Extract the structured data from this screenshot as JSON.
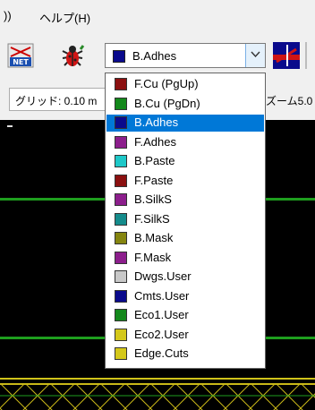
{
  "menubar": {
    "items": [
      "))",
      "ヘルプ(H)"
    ]
  },
  "toolbar": {
    "selected_layer": "B.Adhes",
    "selected_color": "#0a0a8c"
  },
  "status": {
    "grid": "グリッド: 0.10 m",
    "zoom": "ズーム5.0"
  },
  "dropdown": {
    "items": [
      {
        "label": "F.Cu (PgUp)",
        "color": "#8b1010"
      },
      {
        "label": "B.Cu (PgDn)",
        "color": "#13881b"
      },
      {
        "label": "B.Adhes",
        "color": "#0a0a8c",
        "selected": true
      },
      {
        "label": "F.Adhes",
        "color": "#8c1e8c"
      },
      {
        "label": "B.Paste",
        "color": "#1ec8c8"
      },
      {
        "label": "F.Paste",
        "color": "#8b1010"
      },
      {
        "label": "B.SilkS",
        "color": "#8c1e8c"
      },
      {
        "label": "F.SilkS",
        "color": "#158c8c"
      },
      {
        "label": "B.Mask",
        "color": "#858510"
      },
      {
        "label": "F.Mask",
        "color": "#8c1e8c"
      },
      {
        "label": "Dwgs.User",
        "color": "#c8c8c8"
      },
      {
        "label": "Cmts.User",
        "color": "#0a0a8c"
      },
      {
        "label": "Eco1.User",
        "color": "#13881b"
      },
      {
        "label": "Eco2.User",
        "color": "#d4c81a"
      },
      {
        "label": "Edge.Cuts",
        "color": "#d4c81a"
      }
    ]
  }
}
